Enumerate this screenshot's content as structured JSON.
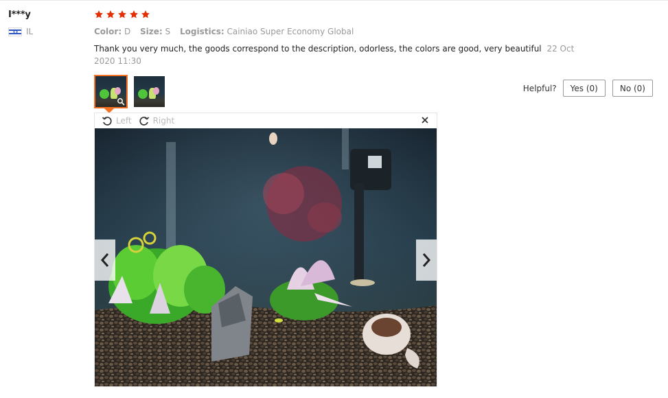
{
  "reviewer": {
    "name": "I***y",
    "country": "IL",
    "flag_icon": "israel-flag-icon"
  },
  "review": {
    "rating": 5,
    "rating_max": 5,
    "star_color": "#e62e04",
    "attributes": [
      {
        "key": "Color:",
        "value": "D"
      },
      {
        "key": "Size:",
        "value": "S"
      },
      {
        "key": "Logistics:",
        "value": "Cainiao Super Economy Global"
      }
    ],
    "text": "Thank you very much, the goods correspond to the description, odorless, the colors are good, very beautiful",
    "date": "22 Oct 2020 11:30"
  },
  "thumbnails": [
    {
      "name": "aquarium-photo-1",
      "active": true
    },
    {
      "name": "aquarium-photo-2",
      "active": false
    }
  ],
  "helpful": {
    "label": "Helpful?",
    "yes_label": "Yes (0)",
    "no_label": "No (0)"
  },
  "viewer": {
    "rotate_left_label": "Left",
    "rotate_right_label": "Right",
    "close_icon": "close-icon",
    "prev_icon": "chevron-left-icon",
    "next_icon": "chevron-right-icon"
  },
  "colors": {
    "accent": "#f57224",
    "muted_text": "#999999"
  }
}
